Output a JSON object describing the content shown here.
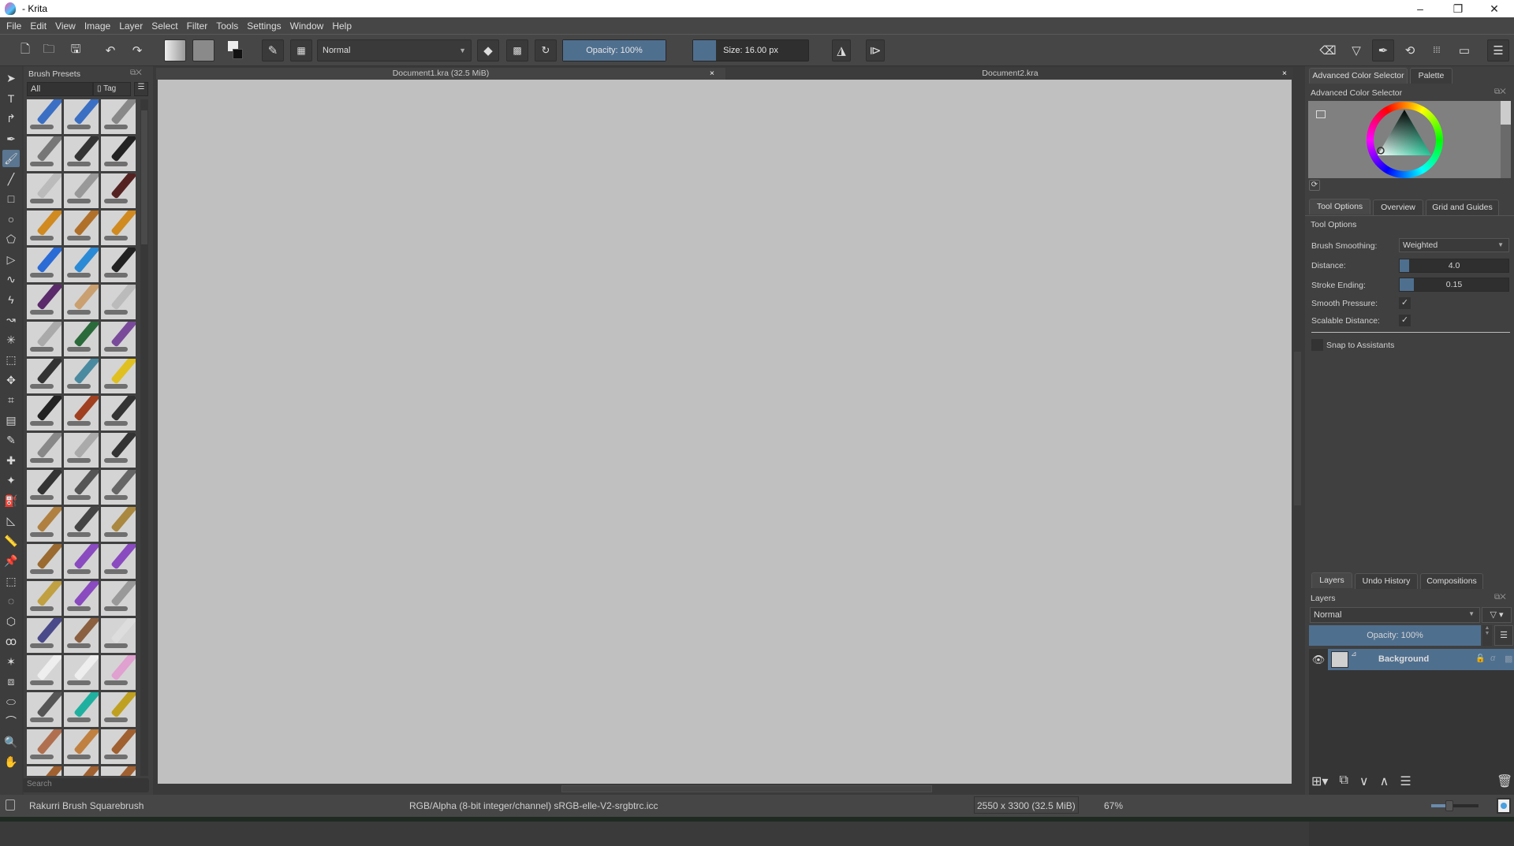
{
  "window": {
    "title": "- Krita",
    "controls": [
      "–",
      "❐",
      "✕"
    ]
  },
  "menu": [
    "File",
    "Edit",
    "View",
    "Image",
    "Layer",
    "Select",
    "Filter",
    "Tools",
    "Settings",
    "Window",
    "Help"
  ],
  "toolbar": {
    "blend_mode": "Normal",
    "opacity_label": "Opacity: 100%",
    "opacity_value": 100,
    "size_label": "Size: 16.00 px",
    "size_fraction": 0.2
  },
  "toolbox": [
    "select-shapes",
    "text",
    "edit-shapes",
    "calligraphy",
    "freehand-brush",
    "line",
    "rectangle",
    "ellipse",
    "polygon",
    "polyline",
    "bezier-curve",
    "freehand-path",
    "dynamic-brush",
    "multibrush",
    "transform",
    "move",
    "crop",
    "gradient",
    "color-picker",
    "smart-patch",
    "colorize-mask",
    "fill",
    "assistant",
    "measure",
    "reference-images",
    "rectangular-selection",
    "elliptical-selection",
    "polygonal-selection",
    "freehand-selection",
    "contiguous-selection",
    "similar-color-selection",
    "bezier-selection",
    "magnetic-selection",
    "zoom",
    "pan"
  ],
  "brush_presets": {
    "title": "Brush Presets",
    "filter": "All",
    "tag_label": "Tag",
    "search_placeholder": "Search",
    "tile_count": 57
  },
  "documents": [
    {
      "name": "Document1.kra (32.5 MiB)",
      "close": "×"
    },
    {
      "name": "Document2.kra",
      "close": "×"
    }
  ],
  "color_panel": {
    "tabs": [
      "Advanced Color Selector",
      "Palette"
    ],
    "title": "Advanced Color Selector"
  },
  "tool_options": {
    "tabs": [
      "Tool Options",
      "Overview",
      "Grid and Guides"
    ],
    "title": "Tool Options",
    "brush_smoothing_label": "Brush Smoothing:",
    "brush_smoothing_value": "Weighted",
    "distance_label": "Distance:",
    "distance_value": "4.0",
    "stroke_ending_label": "Stroke Ending:",
    "stroke_ending_value": "0.15",
    "smooth_pressure_label": "Smooth Pressure:",
    "smooth_pressure_checked": true,
    "scalable_distance_label": "Scalable Distance:",
    "scalable_distance_checked": true,
    "snap_label": "Snap to Assistants",
    "snap_checked": false,
    "check": "✓"
  },
  "layers": {
    "tabs": [
      "Layers",
      "Undo History",
      "Compositions"
    ],
    "title": "Layers",
    "blend_mode": "Normal",
    "opacity_label": "Opacity:  100%",
    "items": [
      {
        "name": "Background",
        "visible": true
      }
    ]
  },
  "status": {
    "brush": "Rakurri Brush Squarebrush",
    "color_space": "RGB/Alpha (8-bit integer/channel)  sRGB-elle-V2-srgbtrc.icc",
    "image_size": "2550 x 3300 (32.5 MiB)",
    "zoom": "67%"
  },
  "colors": {
    "accent": "#4f6f8f",
    "canvas": "#c0c0c0",
    "panel": "#404040"
  }
}
